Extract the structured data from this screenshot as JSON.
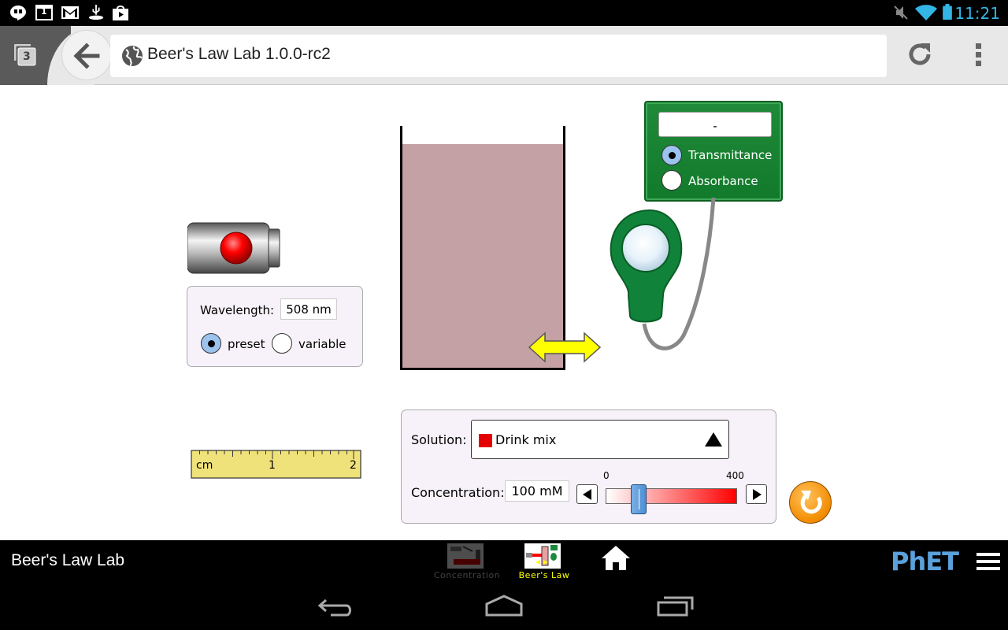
{
  "status_bar": {
    "time": "11:21",
    "icons": [
      "hangouts-icon",
      "calendar-icon",
      "gmail-icon",
      "usb-debug-icon",
      "play-store-icon",
      "mute-icon",
      "wifi-icon",
      "battery-icon"
    ],
    "calendar_day": "1"
  },
  "browser": {
    "tab_count": "3",
    "page_title": "Beer's Law Lab 1.0.0-rc2"
  },
  "light_source": {
    "button_color": "#e00000"
  },
  "wavelength_panel": {
    "label": "Wavelength:",
    "value": "508 nm",
    "mode_options": [
      {
        "label": "preset",
        "selected": true
      },
      {
        "label": "variable",
        "selected": false
      }
    ]
  },
  "cuvette": {
    "solution_color": "#c4a1a4"
  },
  "detector": {
    "display_value": "-",
    "modes": [
      {
        "label": "Transmittance",
        "selected": true
      },
      {
        "label": "Absorbance",
        "selected": false
      }
    ]
  },
  "ruler": {
    "unit": "cm",
    "labels": [
      "1",
      "2"
    ]
  },
  "solution_panel": {
    "solution_label": "Solution:",
    "solution_name": "Drink mix",
    "solution_swatch": "#e40000",
    "concentration_label": "Concentration:",
    "concentration_value": "100 mM",
    "slider_min": "0",
    "slider_max": "400",
    "slider_value": 100,
    "slider_range": [
      0,
      400
    ]
  },
  "navbar": {
    "sim_title": "Beer's Law Lab",
    "screens": [
      {
        "label": "Concentration",
        "selected": false
      },
      {
        "label": "Beer's Law",
        "selected": true
      }
    ],
    "logo": "PhET"
  },
  "colors": {
    "accent_blue": "#33b5e5",
    "meter_green": "#1f8a3a",
    "selected_screen": "#ffff00"
  }
}
